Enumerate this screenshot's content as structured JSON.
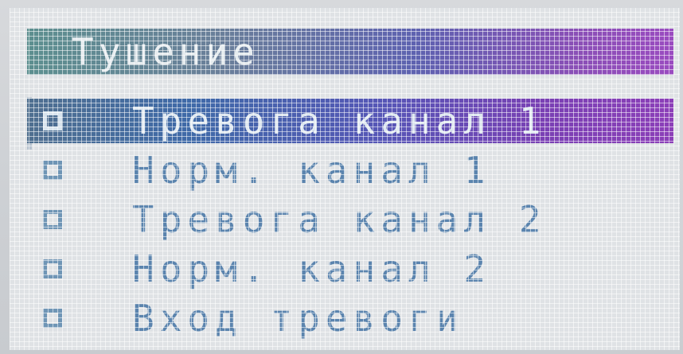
{
  "screen": {
    "title": "Тушение",
    "colors": {
      "background": "#dfe2e5",
      "text": "#5b84ae",
      "highlight_start": "#3f6aa8",
      "highlight_end": "#8c3fb8"
    }
  },
  "menu": {
    "selected_index": 0,
    "items": [
      {
        "label": "Тревога канал 1"
      },
      {
        "label": "Норм. канал 1"
      },
      {
        "label": "Тревога канал 2"
      },
      {
        "label": "Норм. канал 2"
      },
      {
        "label": "Вход тревоги"
      }
    ]
  }
}
